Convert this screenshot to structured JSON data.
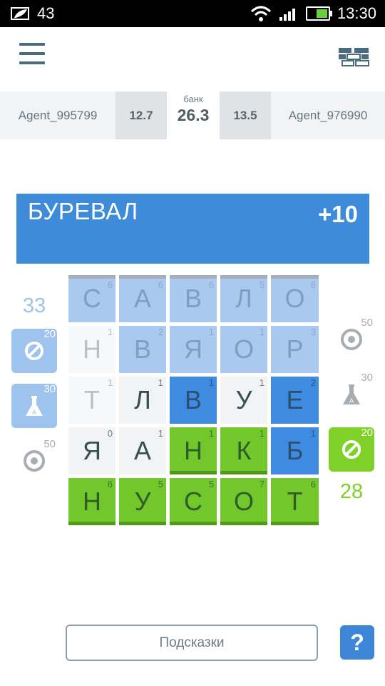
{
  "status": {
    "notification_count": "43",
    "time": "13:30"
  },
  "scores": {
    "left_agent": "Agent_995799",
    "left_score": "12.7",
    "bank_label": "банк",
    "bank_value": "26.3",
    "right_score": "13.5",
    "right_agent": "Agent_976990"
  },
  "banner": {
    "word": "БУРЕВАЛ",
    "points": "+10"
  },
  "board": {
    "tiles": [
      [
        {
          "letter": "С",
          "num": "6",
          "state": "lightblue"
        },
        {
          "letter": "А",
          "num": "6",
          "state": "lightblue"
        },
        {
          "letter": "В",
          "num": "6",
          "state": "lightblue"
        },
        {
          "letter": "Л",
          "num": "5",
          "state": "lightblue"
        },
        {
          "letter": "О",
          "num": "6",
          "state": "lightblue"
        }
      ],
      [
        {
          "letter": "Н",
          "num": "1",
          "state": "white"
        },
        {
          "letter": "В",
          "num": "2",
          "state": "lightblue"
        },
        {
          "letter": "Я",
          "num": "1",
          "state": "lightblue"
        },
        {
          "letter": "О",
          "num": "1",
          "state": "lightblue"
        },
        {
          "letter": "Р",
          "num": "3",
          "state": "lightblue"
        }
      ],
      [
        {
          "letter": "Т",
          "num": "1",
          "state": "white"
        },
        {
          "letter": "Л",
          "num": "1",
          "state": "gray"
        },
        {
          "letter": "В",
          "num": "1",
          "state": "blue"
        },
        {
          "letter": "У",
          "num": "1",
          "state": "gray"
        },
        {
          "letter": "Е",
          "num": "2",
          "state": "blue"
        }
      ],
      [
        {
          "letter": "Я",
          "num": "0",
          "state": "gray"
        },
        {
          "letter": "А",
          "num": "1",
          "state": "gray"
        },
        {
          "letter": "Н",
          "num": "1",
          "state": "green"
        },
        {
          "letter": "К",
          "num": "1",
          "state": "green"
        },
        {
          "letter": "Б",
          "num": "1",
          "state": "blue"
        }
      ],
      [
        {
          "letter": "Н",
          "num": "6",
          "state": "green"
        },
        {
          "letter": "У",
          "num": "5",
          "state": "green"
        },
        {
          "letter": "С",
          "num": "5",
          "state": "green"
        },
        {
          "letter": "О",
          "num": "7",
          "state": "green"
        },
        {
          "letter": "Т",
          "num": "6",
          "state": "green"
        }
      ]
    ]
  },
  "left_player": {
    "score": "33",
    "skip_cost": "20",
    "flask_cost": "30",
    "target_cost": "50"
  },
  "right_player": {
    "score": "28",
    "target_cost": "50",
    "flask_cost": "30",
    "skip_cost": "20"
  },
  "flask_label": "A",
  "colors": {
    "player_blue": "#3d8bd9",
    "player_green": "#72c82a",
    "light_blue": "#a9c9f1"
  },
  "footer": {
    "hints_label": "Подсказки",
    "help_label": "?"
  }
}
